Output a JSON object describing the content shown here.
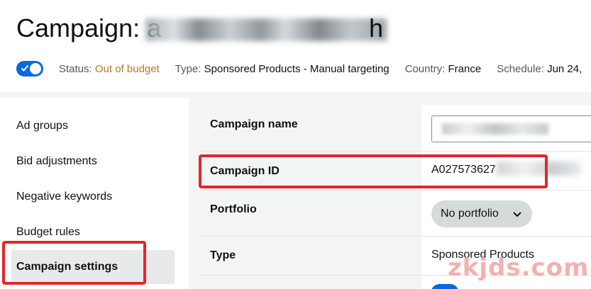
{
  "header": {
    "title_prefix": "Campaign: a",
    "title_tail": "h",
    "status_label": "Status:",
    "status_value": "Out of budget",
    "type_label": "Type:",
    "type_value": "Sponsored Products - Manual targeting",
    "country_label": "Country:",
    "country_value": "France",
    "schedule_label": "Schedule:",
    "schedule_value": "Jun 24,"
  },
  "sidebar": {
    "items": [
      {
        "label": "Ad groups"
      },
      {
        "label": "Bid adjustments"
      },
      {
        "label": "Negative keywords"
      },
      {
        "label": "Budget rules"
      },
      {
        "label": "Campaign settings",
        "active": true
      }
    ]
  },
  "settings": {
    "campaign_name_label": "Campaign name",
    "campaign_id_label": "Campaign ID",
    "campaign_id_value": "A027573627",
    "portfolio_label": "Portfolio",
    "portfolio_value": "No portfolio",
    "type_label": "Type",
    "type_value": "Sponsored Products"
  },
  "watermark": "zkjds.com",
  "colors": {
    "accent": "#0969da",
    "warning": "#b7791f",
    "highlight_box": "#e4262b"
  }
}
